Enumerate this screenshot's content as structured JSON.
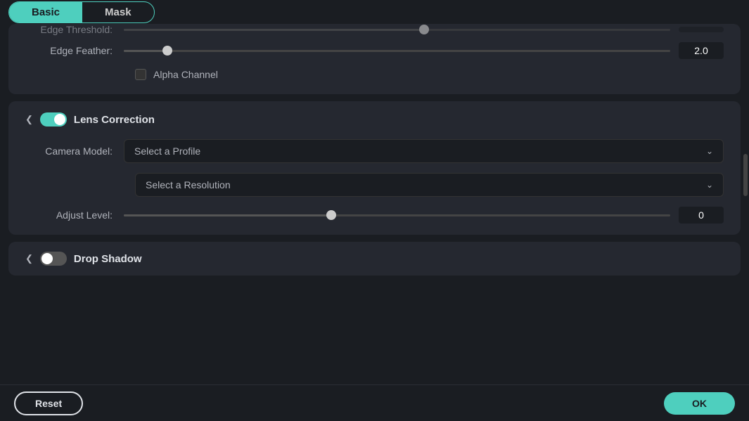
{
  "tabs": {
    "basic_label": "Basic",
    "mask_label": "Mask",
    "active": "basic"
  },
  "edge_section": {
    "edge_feather_label": "Edge Feather:",
    "edge_feather_value": "2.0",
    "edge_feather_slider_pct": 8,
    "alpha_channel_label": "Alpha Channel",
    "edge_threshold_label": "Edge Threshold:"
  },
  "lens_correction": {
    "title": "Lens Correction",
    "camera_model_label": "Camera Model:",
    "camera_model_placeholder": "Select a Profile",
    "resolution_placeholder": "Select a Resolution",
    "adjust_level_label": "Adjust Level:",
    "adjust_level_value": "0",
    "adjust_level_slider_pct": 38
  },
  "drop_shadow": {
    "title": "Drop Shadow"
  },
  "footer": {
    "reset_label": "Reset",
    "ok_label": "OK"
  },
  "icons": {
    "chevron_down": "❯",
    "chevron_right": "›"
  }
}
